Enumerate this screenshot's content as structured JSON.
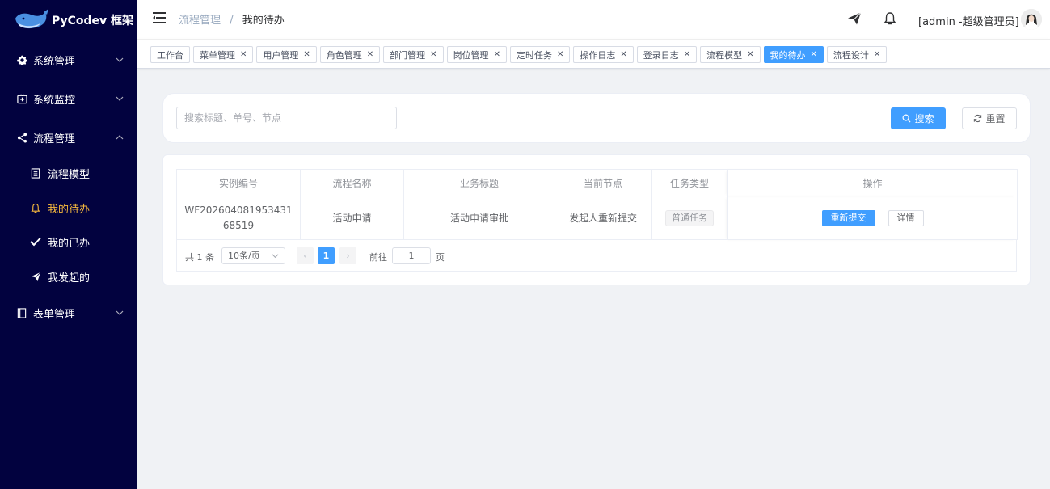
{
  "app": {
    "logo_text": "PyCodev 框架"
  },
  "sidebar": {
    "items": [
      {
        "label": "系统管理",
        "icon": "gear-icon"
      },
      {
        "label": "系统监控",
        "icon": "monitor-icon"
      },
      {
        "label": "流程管理",
        "icon": "share-icon",
        "expanded": true
      },
      {
        "label": "表单管理",
        "icon": "form-icon"
      }
    ],
    "sub_items": [
      {
        "label": "流程模型",
        "icon": "document-icon"
      },
      {
        "label": "我的待办",
        "icon": "bell-icon",
        "active": true
      },
      {
        "label": "我的已办",
        "icon": "check-icon"
      },
      {
        "label": "我发起的",
        "icon": "send-icon"
      }
    ],
    "active_color": "#f5b83d",
    "background": "#02023f"
  },
  "header": {
    "breadcrumb": [
      "流程管理",
      "我的待办"
    ],
    "breadcrumb_sep": "/",
    "user_label": "[admin -超级管理员]"
  },
  "tags": [
    {
      "label": "工作台",
      "closable": false
    },
    {
      "label": "菜单管理",
      "closable": true
    },
    {
      "label": "用户管理",
      "closable": true
    },
    {
      "label": "角色管理",
      "closable": true
    },
    {
      "label": "部门管理",
      "closable": true
    },
    {
      "label": "岗位管理",
      "closable": true
    },
    {
      "label": "定时任务",
      "closable": true
    },
    {
      "label": "操作日志",
      "closable": true
    },
    {
      "label": "登录日志",
      "closable": true
    },
    {
      "label": "流程模型",
      "closable": true
    },
    {
      "label": "我的待办",
      "closable": true,
      "active": true
    },
    {
      "label": "流程设计",
      "closable": true
    }
  ],
  "search": {
    "placeholder": "搜索标题、单号、节点",
    "value": "",
    "search_label": "搜索",
    "reset_label": "重置"
  },
  "table": {
    "columns": [
      "实例编号",
      "流程名称",
      "业务标题",
      "当前节点",
      "任务类型",
      "操作"
    ],
    "rows": [
      {
        "instance_no": "WF20260408195343168519",
        "process_name": "活动申请",
        "business_title": "活动申请审批",
        "current_node": "发起人重新提交",
        "task_type": "普通任务",
        "actions": {
          "resubmit": "重新提交",
          "detail": "详情"
        }
      }
    ]
  },
  "pagination": {
    "total_text": "共 1 条",
    "page_size": "10条/页",
    "current_page": "1",
    "goto_label": "前往",
    "goto_value": "1",
    "page_suffix": "页",
    "prev": "‹",
    "next": "›"
  },
  "colors": {
    "primary": "#409eff"
  }
}
